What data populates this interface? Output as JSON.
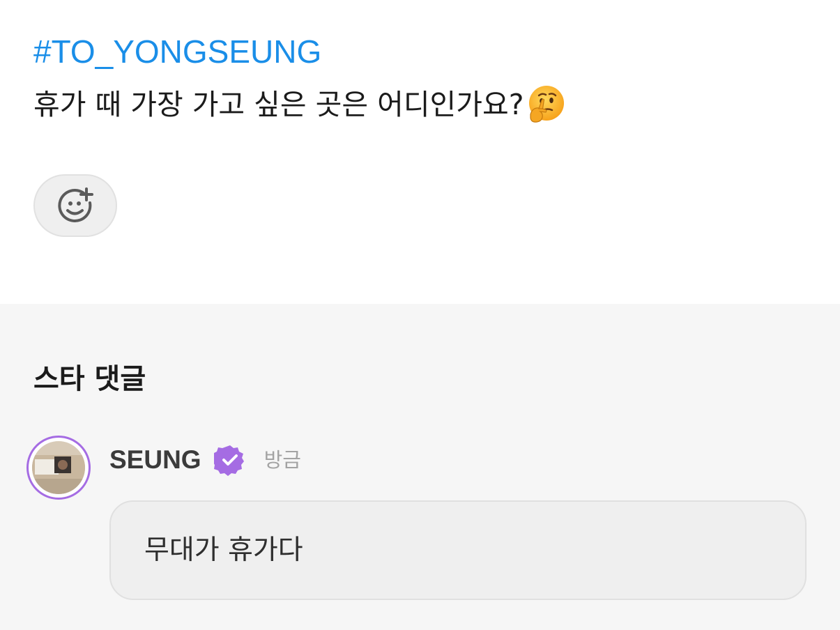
{
  "post": {
    "hashtag": "#TO_YONGSEUNG",
    "question": "휴가 때 가장 가고 싶은 곳은 어디인가요?",
    "question_emoji": "thinking-face-icon",
    "reaction_button_icon": "add-reaction-icon"
  },
  "comments_section": {
    "title": "스타 댓글",
    "comments": [
      {
        "author": "SEUNG",
        "verified_badge": "verified-badge-icon",
        "timestamp": "방금",
        "text": "무대가 휴가다"
      }
    ]
  },
  "colors": {
    "hashtag": "#1a8ee8",
    "verified": "#a56ce3",
    "section_background": "#f6f6f6"
  }
}
